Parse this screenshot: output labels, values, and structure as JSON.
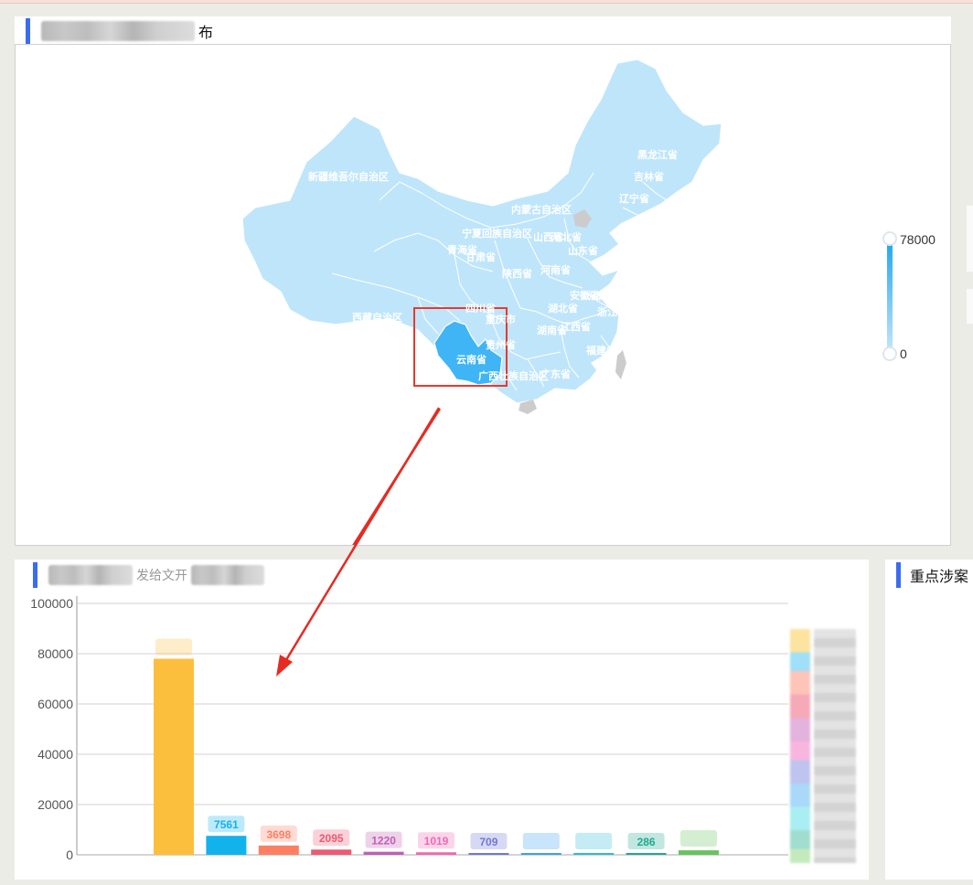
{
  "map_panel": {
    "title_tail": "布",
    "visual_map": {
      "max": "78000",
      "min": "0",
      "high_color": "#1ea7ef",
      "low_color": "#c6e6fb"
    },
    "highlight_color": "#3fb5f5",
    "region_color": "#bfe5fb",
    "provinces": [
      {
        "id": "xinjiang",
        "label": "新疆维吾尔自治区"
      },
      {
        "id": "heilongjiang",
        "label": "黑龙江省"
      },
      {
        "id": "jilin",
        "label": "吉林省"
      },
      {
        "id": "liaoning",
        "label": "辽宁省"
      },
      {
        "id": "neimenggu",
        "label": "内蒙古自治区"
      },
      {
        "id": "ningxia",
        "label": "宁夏回族自治区"
      },
      {
        "id": "shanxi",
        "label": "山西省"
      },
      {
        "id": "hebei",
        "label": "河北省"
      },
      {
        "id": "shandong",
        "label": "山东省"
      },
      {
        "id": "qinghai",
        "label": "青海省"
      },
      {
        "id": "gansu",
        "label": "甘肃省"
      },
      {
        "id": "shaanxi",
        "label": "陕西省"
      },
      {
        "id": "henan",
        "label": "河南省"
      },
      {
        "id": "anhui",
        "label": "安徽省"
      },
      {
        "id": "jiangsu",
        "label": "江苏省"
      },
      {
        "id": "shanghai",
        "label": "上海市"
      },
      {
        "id": "xizang",
        "label": "西藏自治区"
      },
      {
        "id": "sichuan",
        "label": "四川省"
      },
      {
        "id": "chongqing",
        "label": "重庆市"
      },
      {
        "id": "hubei",
        "label": "湖北省"
      },
      {
        "id": "zhejiang",
        "label": "浙江省"
      },
      {
        "id": "guizhou",
        "label": "贵州省"
      },
      {
        "id": "hunan",
        "label": "湖南省"
      },
      {
        "id": "jiangxi",
        "label": "江西省"
      },
      {
        "id": "fujian",
        "label": "福建省"
      },
      {
        "id": "yunnan",
        "label": "云南省"
      },
      {
        "id": "guangxi",
        "label": "广西壮族自治区"
      },
      {
        "id": "guangdong",
        "label": "广东省"
      }
    ]
  },
  "chart_panel": {
    "title_fragment": "发给文开"
  },
  "right_panel": {
    "title": "重点涉案"
  },
  "chart_data": {
    "type": "bar",
    "ylim": [
      0,
      100000
    ],
    "yticks": [
      "0",
      "20000",
      "40000",
      "60000",
      "80000",
      "100000"
    ],
    "bars": [
      {
        "value": 78000,
        "label": "",
        "color": "#fcbf3d"
      },
      {
        "value": 7561,
        "label": "7561",
        "color": "#12b3ec"
      },
      {
        "value": 3698,
        "label": "3698",
        "color": "#fd7f63"
      },
      {
        "value": 2095,
        "label": "2095",
        "color": "#ee5a73"
      },
      {
        "value": 1220,
        "label": "1220",
        "color": "#c35fb4"
      },
      {
        "value": 1019,
        "label": "1019",
        "color": "#ee69b4"
      },
      {
        "value": 709,
        "label": "709",
        "color": "#6f76d8"
      },
      {
        "value": 500,
        "label": "",
        "color": "#3ba1f0"
      },
      {
        "value": 400,
        "label": "",
        "color": "#2cbcd6"
      },
      {
        "value": 286,
        "label": "286",
        "color": "#20a990"
      },
      {
        "value": 1800,
        "label": "",
        "color": "#66c35f"
      }
    ]
  }
}
